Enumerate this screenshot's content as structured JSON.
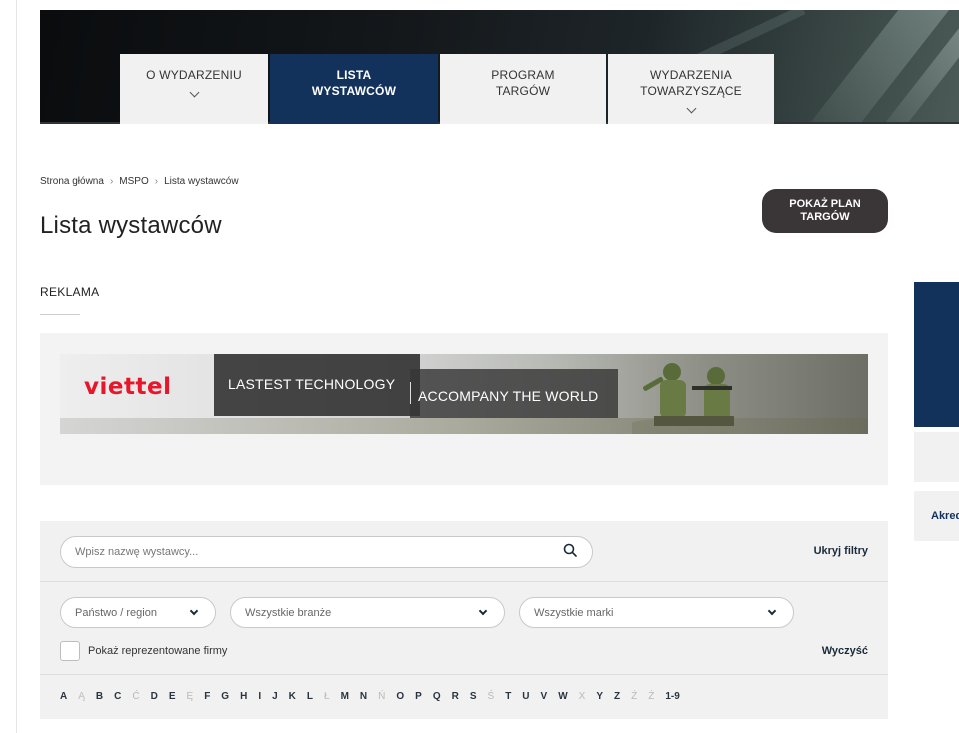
{
  "nav": {
    "items": [
      {
        "label": "O WYDARZENIU",
        "has_dropdown": true
      },
      {
        "label": "LISTA\nWYSTAWCÓW",
        "has_dropdown": false,
        "active": true
      },
      {
        "label": "PROGRAM\nTARGÓW",
        "has_dropdown": false
      },
      {
        "label": "WYDARZENIA\nTOWARZYSZĄCE",
        "has_dropdown": true
      }
    ]
  },
  "breadcrumb": {
    "items": [
      "Strona główna",
      "MSPO",
      "Lista wystawców"
    ],
    "separator": "›"
  },
  "page": {
    "title": "Lista wystawców",
    "plan_button": "POKAŻ PLAN\nTARGÓW",
    "ad_section_label": "REKLAMA"
  },
  "ad": {
    "brand": "viettel",
    "text1": "LASTEST TECHNOLOGY",
    "text2": "ACCOMPANY THE WORLD",
    "brand_color": "#e8162b"
  },
  "filters": {
    "search_placeholder": "Wpisz nazwę wystawcy...",
    "hide_filters": "Ukryj filtry",
    "country": "Państwo / region",
    "industry": "Wszystkie branże",
    "brands": "Wszystkie marki",
    "show_represented": "Pokaż reprezentowane firmy",
    "clear": "Wyczyść"
  },
  "alphabet": {
    "letters": [
      "A",
      "Ą",
      "B",
      "C",
      "Ć",
      "D",
      "E",
      "Ę",
      "F",
      "G",
      "H",
      "I",
      "J",
      "K",
      "L",
      "Ł",
      "M",
      "N",
      "Ń",
      "O",
      "P",
      "Q",
      "R",
      "S",
      "Ś",
      "T",
      "U",
      "V",
      "W",
      "X",
      "Y",
      "Z",
      "Ź",
      "Ż",
      "1-9"
    ],
    "disabled": [
      "Ą",
      "Ć",
      "Ę",
      "Ł",
      "Ń",
      "Ś",
      "X",
      "Ź",
      "Ż"
    ]
  },
  "sidebar": {
    "partial_text": "Akred"
  },
  "colors": {
    "navy": "#12325c",
    "dark_button": "#3a3537",
    "filter_bg": "#f1f1f1"
  }
}
